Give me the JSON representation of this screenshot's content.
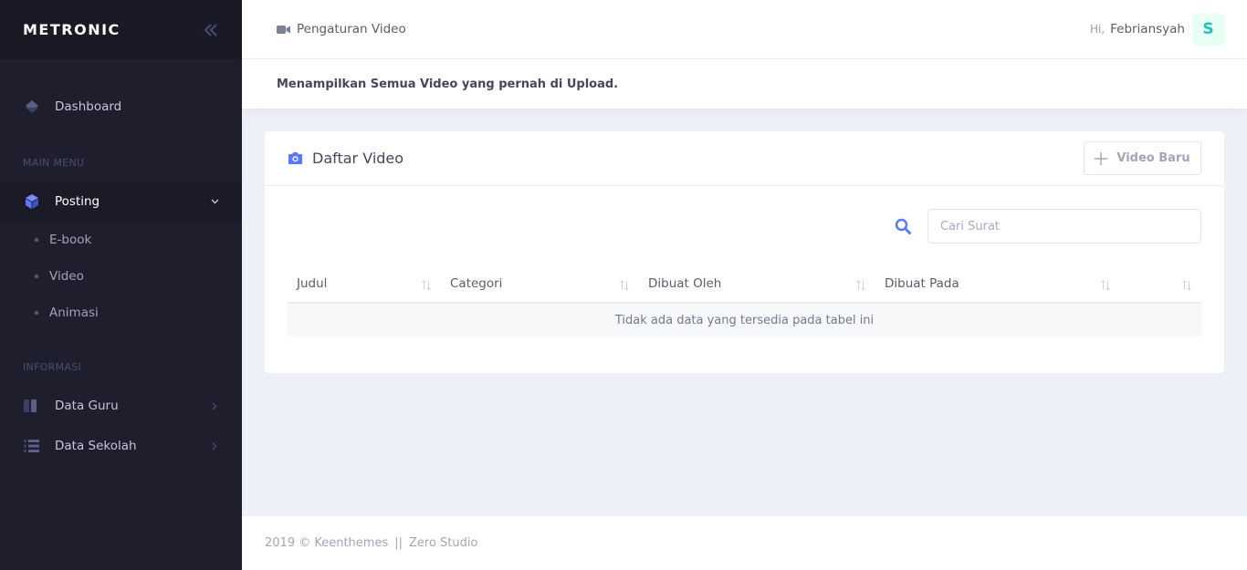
{
  "app": {
    "brand": "METRONIC"
  },
  "sidebar": {
    "dashboard_label": "Dashboard",
    "section_main": "MAIN MENU",
    "posting_label": "Posting",
    "posting_submenu": [
      "E-book",
      "Video",
      "Animasi"
    ],
    "section_info": "INFORMASI",
    "data_guru_label": "Data Guru",
    "data_sekolah_label": "Data Sekolah"
  },
  "header": {
    "title": "Pengaturan Video",
    "greeting": "Hi,",
    "username": "Febriansyah",
    "avatar_letter": "S"
  },
  "subheader": {
    "text": "Menampilkan Semua Video yang pernah di Upload."
  },
  "card": {
    "title": "Daftar Video",
    "new_button_label": "Video Baru",
    "search_placeholder": "Cari Surat",
    "columns": [
      "Judul",
      "Categori",
      "Dibuat Oleh",
      "Dibuat Pada",
      ""
    ],
    "empty_message": "Tidak ada data yang tersedia pada tabel ini"
  },
  "footer": {
    "copyright": "2019 © Keenthemes",
    "separator": "||",
    "studio": "Zero Studio"
  },
  "colors": {
    "sidebar_bg": "#1e1e2d",
    "accent": "#5d78ff",
    "avatar_bg": "#e8fff3",
    "avatar_text": "#1bc5bd"
  }
}
